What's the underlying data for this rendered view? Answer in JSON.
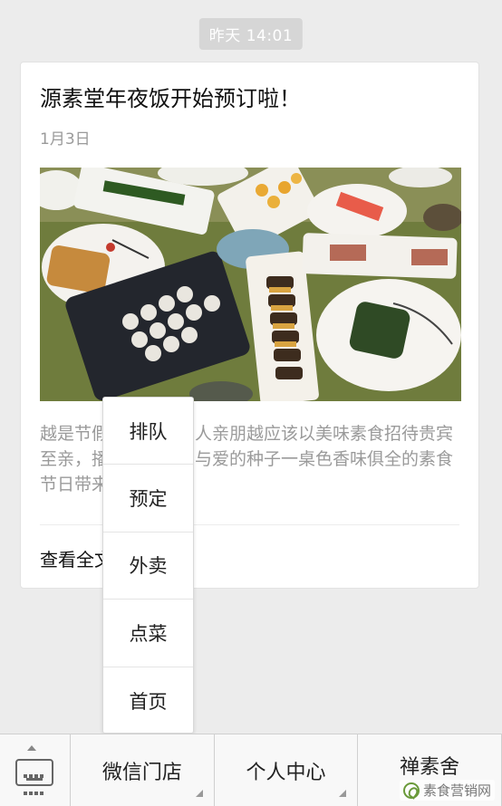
{
  "timestamp": "昨天 14:01",
  "article": {
    "title": "源素堂年夜饭开始预订啦！",
    "date": "1月3日",
    "image_alt": "photo-of-banquet-dishes",
    "desc": "越是节假日，越是亲人亲朋越应该以美味素食招待贵宾至亲，播亲朋种下善与爱的种子一桌色香味俱全的素食节日带来",
    "read_more": "查看全文"
  },
  "popup_menu": {
    "items": [
      "排队",
      "预定",
      "外卖",
      "点菜",
      "首页"
    ]
  },
  "bottom_bar": {
    "keyboard_icon": "keyboard-icon",
    "menus": [
      {
        "label": "微信门店"
      },
      {
        "label": "个人中心"
      },
      {
        "label": "禅素舍"
      }
    ]
  },
  "watermark": {
    "text": "素食营销网"
  },
  "colors": {
    "background": "#ececec",
    "card": "#ffffff",
    "muted_text": "#9a9a9a",
    "timestamp_bg": "#d6d6d6"
  }
}
